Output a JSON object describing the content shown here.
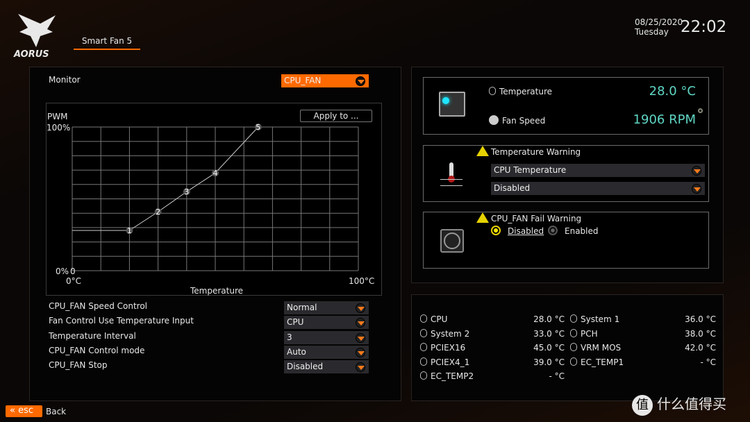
{
  "header": {
    "brand": "AORUS",
    "tab": "Smart Fan 5",
    "date": "08/25/2020",
    "day": "Tuesday",
    "time": "22:02"
  },
  "monitor": {
    "label": "Monitor",
    "value": "CPU_FAN"
  },
  "apply_button": "Apply to ...",
  "chart_data": {
    "type": "line",
    "ylabel": "PWM",
    "xlabel": "Temperature",
    "y_ticks": [
      "100%",
      "0%"
    ],
    "x_ticks": [
      "0°C",
      "100°C"
    ],
    "origin_label": "0",
    "xlim": [
      0,
      100
    ],
    "ylim": [
      0,
      100
    ],
    "grid": true,
    "points": [
      {
        "label": "1",
        "x": 20,
        "y": 28
      },
      {
        "label": "2",
        "x": 30,
        "y": 41
      },
      {
        "label": "3",
        "x": 40,
        "y": 55
      },
      {
        "label": "4",
        "x": 50,
        "y": 68
      },
      {
        "label": "5",
        "x": 65,
        "y": 100
      }
    ]
  },
  "settings": [
    {
      "label": "CPU_FAN Speed Control",
      "value": "Normal"
    },
    {
      "label": "Fan Control Use Temperature Input",
      "value": "CPU"
    },
    {
      "label": "Temperature Interval",
      "value": "3"
    },
    {
      "label": "CPU_FAN Control mode",
      "value": "Auto"
    },
    {
      "label": "CPU_FAN Stop",
      "value": "Disabled"
    }
  ],
  "status": {
    "temp_label": "Temperature",
    "temp_value": "28.0 °C",
    "fan_label": "Fan Speed",
    "fan_value": "1906 RPM",
    "accent": "#5fd6c4"
  },
  "temp_warning": {
    "title": "Temperature Warning",
    "source": "CPU Temperature",
    "value": "Disabled"
  },
  "fail_warning": {
    "title": "CPU_FAN Fail Warning",
    "options": [
      "Disabled",
      "Enabled"
    ],
    "selected": "Disabled"
  },
  "sensors": [
    {
      "name": "CPU",
      "value": "28.0 °C"
    },
    {
      "name": "System 1",
      "value": "36.0 °C"
    },
    {
      "name": "System 2",
      "value": "33.0 °C"
    },
    {
      "name": "PCH",
      "value": "38.0 °C"
    },
    {
      "name": "PCIEX16",
      "value": "45.0 °C"
    },
    {
      "name": "VRM MOS",
      "value": "42.0 °C"
    },
    {
      "name": "PCIEX4_1",
      "value": "39.0 °C"
    },
    {
      "name": "EC_TEMP1",
      "value": "- °C"
    },
    {
      "name": "EC_TEMP2",
      "value": "- °C"
    }
  ],
  "footer": {
    "esc": "esc",
    "back": "Back"
  },
  "watermark": "值 什么值得买",
  "colors": {
    "orange": "#ff6a00",
    "warning": "#e6d200"
  }
}
